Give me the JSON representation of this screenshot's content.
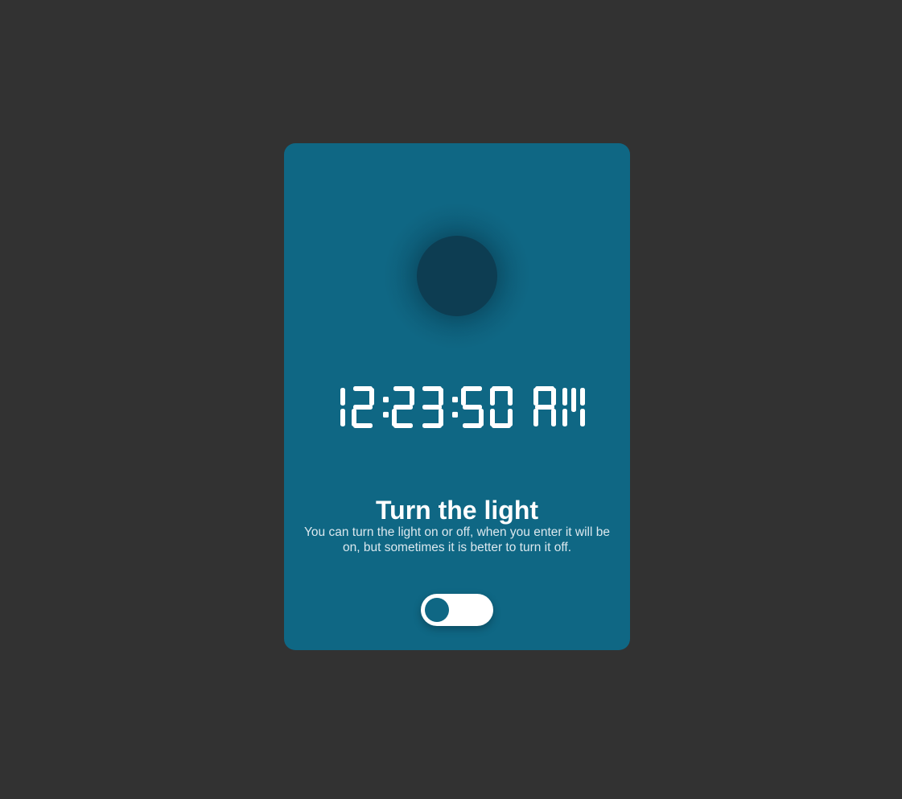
{
  "clock": {
    "time": "12:23:50 AM"
  },
  "panel": {
    "title": "Turn the light",
    "description": "You can turn the light on or off, when you enter it will be on, but sometimes it is better to turn it off."
  },
  "light_toggle": {
    "state": "off"
  },
  "colors": {
    "page_background": "#323232",
    "card_background": "#0f6784",
    "bulb_off": "#0d3d52",
    "text": "#ffffff"
  }
}
